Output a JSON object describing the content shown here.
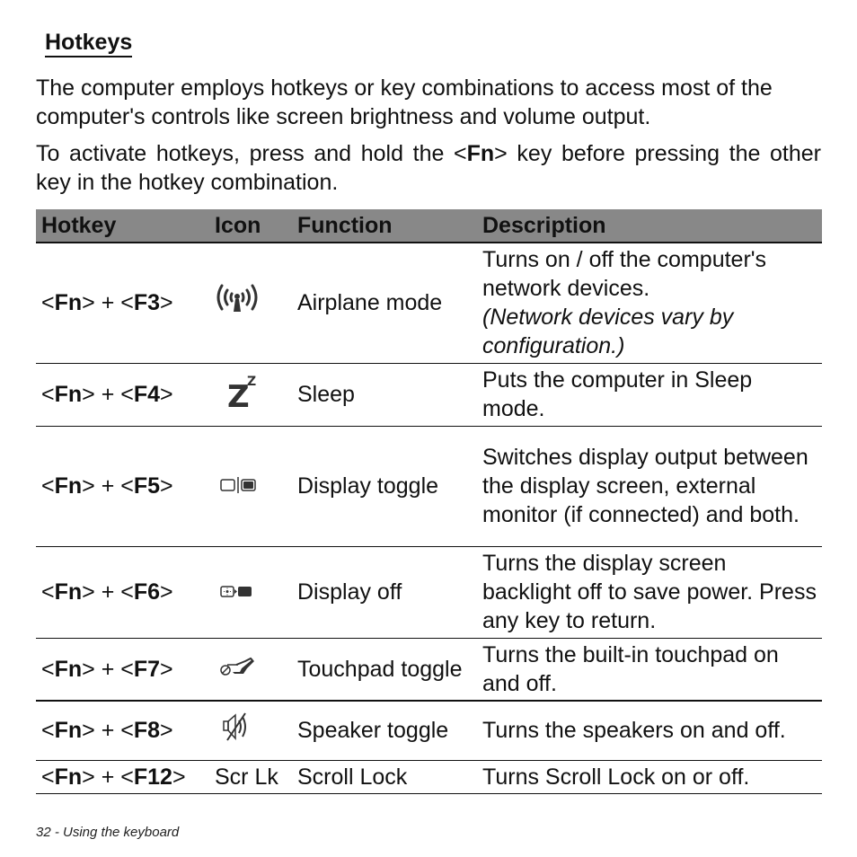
{
  "heading": "Hotkeys",
  "paragraphs": {
    "p1": "The computer employs hotkeys or key combinations to access most of the computer's controls like screen brightness and volume output.",
    "p2_before": "To activate hotkeys, press and hold the <",
    "p2_key": "Fn",
    "p2_after": "> key before pressing the other key in the hotkey combination."
  },
  "table": {
    "headers": {
      "hotkey": "Hotkey",
      "icon": "Icon",
      "function": "Function",
      "description": "Description"
    },
    "rows": [
      {
        "mod": "Fn",
        "key": "F3",
        "icon": "airplane-mode-icon",
        "function": "Airplane mode",
        "description": "Turns on / off the computer's network devices.",
        "note": "(Network devices vary by configuration.)"
      },
      {
        "mod": "Fn",
        "key": "F4",
        "icon": "sleep-icon",
        "function": "Sleep",
        "description": "Puts the computer in Sleep mode.",
        "note": ""
      },
      {
        "mod": "Fn",
        "key": "F5",
        "icon": "display-toggle-icon",
        "function": "Display toggle",
        "description": "Switches display output between the display screen, external monitor (if connected) and both.",
        "note": ""
      },
      {
        "mod": "Fn",
        "key": "F6",
        "icon": "display-off-icon",
        "function": "Display off",
        "description": "Turns the display screen backlight off to save power. Press any key to return.",
        "note": ""
      },
      {
        "mod": "Fn",
        "key": "F7",
        "icon": "touchpad-toggle-icon",
        "function": "Touchpad toggle",
        "description": "Turns the built-in touchpad on and off.",
        "note": ""
      },
      {
        "mod": "Fn",
        "key": "F8",
        "icon": "speaker-toggle-icon",
        "function": "Speaker toggle",
        "description": "Turns the speakers on and off.",
        "note": ""
      },
      {
        "mod": "Fn",
        "key": "F12",
        "icon_text": "Scr Lk",
        "function": "Scroll Lock",
        "description": "Turns Scroll Lock on or off.",
        "note": ""
      }
    ]
  },
  "footer": "32 - Using the keyboard",
  "colors": {
    "header_bg": "#888888",
    "text": "#111111"
  }
}
